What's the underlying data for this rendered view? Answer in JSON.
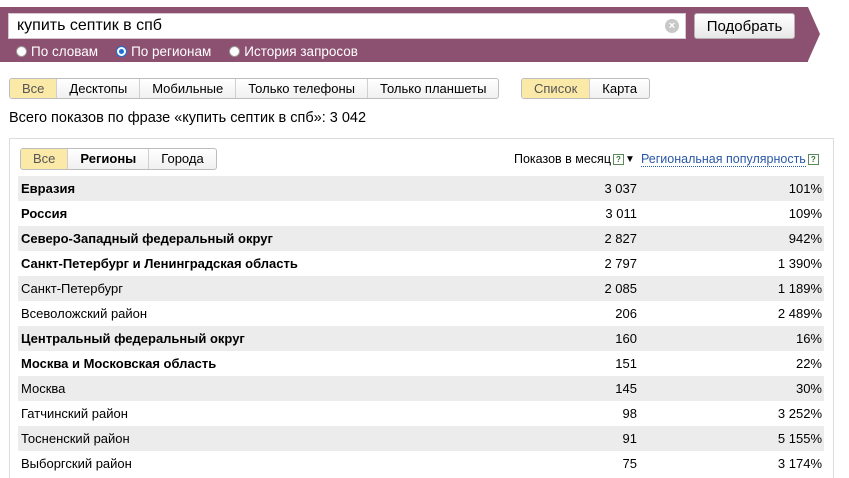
{
  "search": {
    "value": "купить септик в спб",
    "submit_label": "Подобрать",
    "radio_options": [
      {
        "label": "По словам",
        "checked": false
      },
      {
        "label": "По регионам",
        "checked": true
      },
      {
        "label": "История запросов",
        "checked": false
      }
    ]
  },
  "device_filter": [
    "Все",
    "Десктопы",
    "Мобильные",
    "Только телефоны",
    "Только планшеты"
  ],
  "view_filter": [
    "Список",
    "Карта"
  ],
  "total_text": "Всего показов по фразе «купить септик в спб»: 3 042",
  "region_filter": [
    "Все",
    "Регионы",
    "Города"
  ],
  "columns": {
    "shows": "Показов в месяц",
    "popularity": "Региональная популярность"
  },
  "rows": [
    {
      "name": "Евразия",
      "shows": "3 037",
      "pop": "101%",
      "bold": true
    },
    {
      "name": "Россия",
      "shows": "3 011",
      "pop": "109%",
      "bold": true
    },
    {
      "name": "Северо-Западный федеральный округ",
      "shows": "2 827",
      "pop": "942%",
      "bold": true
    },
    {
      "name": "Санкт-Петербург и Ленинградская область",
      "shows": "2 797",
      "pop": "1 390%",
      "bold": true
    },
    {
      "name": "Санкт-Петербург",
      "shows": "2 085",
      "pop": "1 189%",
      "bold": false
    },
    {
      "name": "Всеволожский район",
      "shows": "206",
      "pop": "2 489%",
      "bold": false
    },
    {
      "name": "Центральный федеральный округ",
      "shows": "160",
      "pop": "16%",
      "bold": true
    },
    {
      "name": "Москва и Московская область",
      "shows": "151",
      "pop": "22%",
      "bold": true
    },
    {
      "name": "Москва",
      "shows": "145",
      "pop": "30%",
      "bold": false
    },
    {
      "name": "Гатчинский район",
      "shows": "98",
      "pop": "3 252%",
      "bold": false
    },
    {
      "name": "Тосненский район",
      "shows": "91",
      "pop": "5 155%",
      "bold": false
    },
    {
      "name": "Выборгский район",
      "shows": "75",
      "pop": "3 174%",
      "bold": false
    }
  ]
}
